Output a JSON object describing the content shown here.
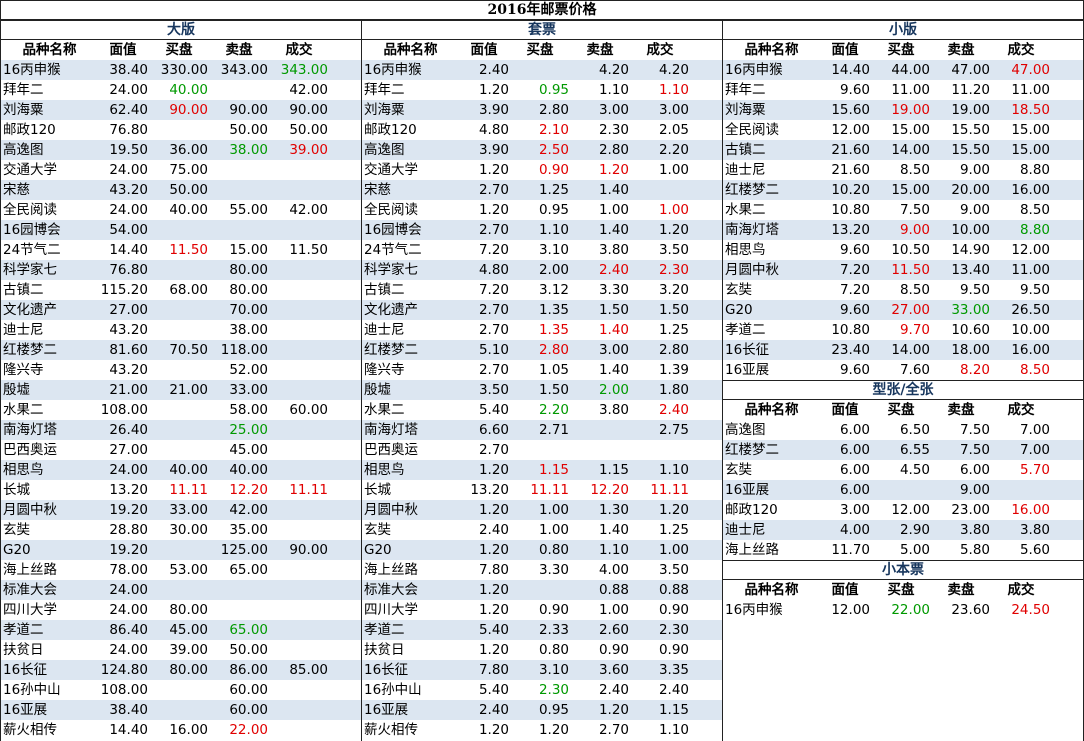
{
  "title": "2016年邮票价格",
  "headers": [
    "品种名称",
    "面值",
    "买盘",
    "卖盘",
    "成交"
  ],
  "sections": {
    "large": {
      "title": "大版",
      "rows": [
        [
          "16丙申猴",
          "38.40",
          "330.00",
          "343.00",
          "343.00"
        ],
        [
          "拜年二",
          "24.00",
          "40.00",
          "",
          "42.00"
        ],
        [
          "刘海粟",
          "62.40",
          "90.00",
          "90.00",
          "90.00"
        ],
        [
          "邮政120",
          "76.80",
          "",
          "50.00",
          "50.00"
        ],
        [
          "高逸图",
          "19.50",
          "36.00",
          "38.00",
          "39.00"
        ],
        [
          "交通大学",
          "24.00",
          "75.00",
          "",
          ""
        ],
        [
          "宋慈",
          "43.20",
          "50.00",
          "",
          ""
        ],
        [
          "全民阅读",
          "24.00",
          "40.00",
          "55.00",
          "42.00"
        ],
        [
          "16园博会",
          "54.00",
          "",
          "",
          ""
        ],
        [
          "24节气二",
          "14.40",
          "11.50",
          "15.00",
          "11.50"
        ],
        [
          "科学家七",
          "76.80",
          "",
          "80.00",
          ""
        ],
        [
          "古镇二",
          "115.20",
          "68.00",
          "80.00",
          ""
        ],
        [
          "文化遗产",
          "27.00",
          "",
          "70.00",
          ""
        ],
        [
          "迪士尼",
          "43.20",
          "",
          "38.00",
          ""
        ],
        [
          "红楼梦二",
          "81.60",
          "70.50",
          "118.00",
          ""
        ],
        [
          "隆兴寺",
          "43.20",
          "",
          "52.00",
          ""
        ],
        [
          "殷墟",
          "21.00",
          "21.00",
          "33.00",
          ""
        ],
        [
          "水果二",
          "108.00",
          "",
          "58.00",
          "60.00"
        ],
        [
          "南海灯塔",
          "26.40",
          "",
          "25.00",
          ""
        ],
        [
          "巴西奥运",
          "27.00",
          "",
          "45.00",
          ""
        ],
        [
          "相思鸟",
          "24.00",
          "40.00",
          "40.00",
          ""
        ],
        [
          "长城",
          "13.20",
          "11.11",
          "12.20",
          "11.11"
        ],
        [
          "月圆中秋",
          "19.20",
          "33.00",
          "42.00",
          ""
        ],
        [
          "玄奘",
          "28.80",
          "30.00",
          "35.00",
          ""
        ],
        [
          "G20",
          "19.20",
          "",
          "125.00",
          "90.00"
        ],
        [
          "海上丝路",
          "78.00",
          "53.00",
          "65.00",
          ""
        ],
        [
          "标准大会",
          "24.00",
          "",
          "",
          ""
        ],
        [
          "四川大学",
          "24.00",
          "80.00",
          "",
          ""
        ],
        [
          "孝道二",
          "86.40",
          "45.00",
          "65.00",
          ""
        ],
        [
          "扶贫日",
          "24.00",
          "39.00",
          "50.00",
          ""
        ],
        [
          "16长征",
          "124.80",
          "80.00",
          "86.00",
          "85.00"
        ],
        [
          "16孙中山",
          "108.00",
          "",
          "60.00",
          ""
        ],
        [
          "16亚展",
          "38.40",
          "",
          "60.00",
          ""
        ],
        [
          "薪火相传",
          "14.40",
          "16.00",
          "22.00",
          ""
        ]
      ],
      "colors": [
        [
          "",
          "",
          "",
          "",
          "green"
        ],
        [
          "",
          "",
          "green",
          "",
          ""
        ],
        [
          "",
          "",
          "red",
          "",
          ""
        ],
        [
          "",
          "",
          "",
          "",
          ""
        ],
        [
          "",
          "",
          "",
          "green",
          "red"
        ],
        [
          "",
          "",
          "",
          "",
          ""
        ],
        [
          "",
          "",
          "",
          "",
          ""
        ],
        [
          "",
          "",
          "",
          "",
          ""
        ],
        [
          "",
          "",
          "",
          "",
          ""
        ],
        [
          "",
          "",
          "red",
          "",
          ""
        ],
        [
          "",
          "",
          "",
          "",
          ""
        ],
        [
          "",
          "",
          "",
          "",
          ""
        ],
        [
          "",
          "",
          "",
          "",
          ""
        ],
        [
          "",
          "",
          "",
          "",
          ""
        ],
        [
          "",
          "",
          "",
          "",
          ""
        ],
        [
          "",
          "",
          "",
          "",
          ""
        ],
        [
          "",
          "",
          "",
          "",
          ""
        ],
        [
          "",
          "",
          "",
          "",
          ""
        ],
        [
          "",
          "",
          "",
          "green",
          ""
        ],
        [
          "",
          "",
          "",
          "",
          ""
        ],
        [
          "",
          "",
          "",
          "",
          ""
        ],
        [
          "",
          "",
          "red",
          "red",
          "red"
        ],
        [
          "",
          "",
          "",
          "",
          ""
        ],
        [
          "",
          "",
          "",
          "",
          ""
        ],
        [
          "",
          "",
          "",
          "",
          ""
        ],
        [
          "",
          "",
          "",
          "",
          ""
        ],
        [
          "",
          "",
          "",
          "",
          ""
        ],
        [
          "",
          "",
          "",
          "",
          ""
        ],
        [
          "",
          "",
          "",
          "green",
          ""
        ],
        [
          "",
          "",
          "",
          "",
          ""
        ],
        [
          "",
          "",
          "",
          "",
          ""
        ],
        [
          "",
          "",
          "",
          "",
          ""
        ],
        [
          "",
          "",
          "",
          "",
          ""
        ],
        [
          "",
          "",
          "",
          "red",
          ""
        ]
      ]
    },
    "sets": {
      "title": "套票",
      "rows": [
        [
          "16丙申猴",
          "2.40",
          "",
          "4.20",
          "4.20"
        ],
        [
          "拜年二",
          "1.20",
          "0.95",
          "1.10",
          "1.10"
        ],
        [
          "刘海粟",
          "3.90",
          "2.80",
          "3.00",
          "3.00"
        ],
        [
          "邮政120",
          "4.80",
          "2.10",
          "2.30",
          "2.05"
        ],
        [
          "高逸图",
          "3.90",
          "2.50",
          "2.80",
          "2.20"
        ],
        [
          "交通大学",
          "1.20",
          "0.90",
          "1.20",
          "1.00"
        ],
        [
          "宋慈",
          "2.70",
          "1.25",
          "1.40",
          ""
        ],
        [
          "全民阅读",
          "1.20",
          "0.95",
          "1.00",
          "1.00"
        ],
        [
          "16园博会",
          "2.70",
          "1.10",
          "1.40",
          "1.20"
        ],
        [
          "24节气二",
          "7.20",
          "3.10",
          "3.80",
          "3.50"
        ],
        [
          "科学家七",
          "4.80",
          "2.00",
          "2.40",
          "2.30"
        ],
        [
          "古镇二",
          "7.20",
          "3.12",
          "3.30",
          "3.20"
        ],
        [
          "文化遗产",
          "2.70",
          "1.35",
          "1.50",
          "1.50"
        ],
        [
          "迪士尼",
          "2.70",
          "1.35",
          "1.40",
          "1.25"
        ],
        [
          "红楼梦二",
          "5.10",
          "2.80",
          "3.00",
          "2.80"
        ],
        [
          "隆兴寺",
          "2.70",
          "1.05",
          "1.40",
          "1.39"
        ],
        [
          "殷墟",
          "3.50",
          "1.50",
          "2.00",
          "1.80"
        ],
        [
          "水果二",
          "5.40",
          "2.20",
          "3.80",
          "2.40"
        ],
        [
          "南海灯塔",
          "6.60",
          "2.71",
          "",
          "2.75"
        ],
        [
          "巴西奥运",
          "2.70",
          "",
          "",
          ""
        ],
        [
          "相思鸟",
          "1.20",
          "1.15",
          "1.15",
          "1.10"
        ],
        [
          "长城",
          "13.20",
          "11.11",
          "12.20",
          "11.11"
        ],
        [
          "月圆中秋",
          "1.20",
          "1.00",
          "1.30",
          "1.20"
        ],
        [
          "玄奘",
          "2.40",
          "1.00",
          "1.40",
          "1.25"
        ],
        [
          "G20",
          "1.20",
          "0.80",
          "1.10",
          "1.00"
        ],
        [
          "海上丝路",
          "7.80",
          "3.30",
          "4.00",
          "3.50"
        ],
        [
          "标准大会",
          "1.20",
          "",
          "0.88",
          "0.88"
        ],
        [
          "四川大学",
          "1.20",
          "0.90",
          "1.00",
          "0.90"
        ],
        [
          "孝道二",
          "5.40",
          "2.33",
          "2.60",
          "2.30"
        ],
        [
          "扶贫日",
          "1.20",
          "0.80",
          "0.90",
          "0.90"
        ],
        [
          "16长征",
          "7.80",
          "3.10",
          "3.60",
          "3.35"
        ],
        [
          "16孙中山",
          "5.40",
          "2.30",
          "2.40",
          "2.40"
        ],
        [
          "16亚展",
          "2.40",
          "0.95",
          "1.20",
          "1.15"
        ],
        [
          "薪火相传",
          "1.20",
          "1.20",
          "2.70",
          "1.10"
        ]
      ],
      "colors": [
        [
          "",
          "",
          "",
          "",
          ""
        ],
        [
          "",
          "",
          "green",
          "",
          "red"
        ],
        [
          "",
          "",
          "",
          "",
          ""
        ],
        [
          "",
          "",
          "red",
          "",
          ""
        ],
        [
          "",
          "",
          "red",
          "",
          ""
        ],
        [
          "",
          "",
          "red",
          "red",
          ""
        ],
        [
          "",
          "",
          "",
          "",
          ""
        ],
        [
          "",
          "",
          "",
          "",
          "red"
        ],
        [
          "",
          "",
          "",
          "",
          ""
        ],
        [
          "",
          "",
          "",
          "",
          ""
        ],
        [
          "",
          "",
          "",
          "red",
          "red"
        ],
        [
          "",
          "",
          "",
          "",
          ""
        ],
        [
          "",
          "",
          "",
          "",
          ""
        ],
        [
          "",
          "",
          "red",
          "red",
          ""
        ],
        [
          "",
          "",
          "red",
          "",
          ""
        ],
        [
          "",
          "",
          "",
          "",
          ""
        ],
        [
          "",
          "",
          "",
          "green",
          ""
        ],
        [
          "",
          "",
          "green",
          "",
          "red"
        ],
        [
          "",
          "",
          "",
          "",
          ""
        ],
        [
          "",
          "",
          "",
          "",
          ""
        ],
        [
          "",
          "",
          "red",
          "",
          ""
        ],
        [
          "",
          "",
          "red",
          "red",
          "red"
        ],
        [
          "",
          "",
          "",
          "",
          ""
        ],
        [
          "",
          "",
          "",
          "",
          ""
        ],
        [
          "",
          "",
          "",
          "",
          ""
        ],
        [
          "",
          "",
          "",
          "",
          ""
        ],
        [
          "",
          "",
          "",
          "",
          ""
        ],
        [
          "",
          "",
          "",
          "",
          ""
        ],
        [
          "",
          "",
          "",
          "",
          ""
        ],
        [
          "",
          "",
          "",
          "",
          ""
        ],
        [
          "",
          "",
          "",
          "",
          ""
        ],
        [
          "",
          "",
          "green",
          "",
          ""
        ],
        [
          "",
          "",
          "",
          "",
          ""
        ],
        [
          "",
          "",
          "",
          "",
          ""
        ]
      ]
    },
    "small": {
      "title": "小版",
      "rows": [
        [
          "16丙申猴",
          "14.40",
          "44.00",
          "47.00",
          "47.00"
        ],
        [
          "拜年二",
          "9.60",
          "11.00",
          "11.20",
          "11.00"
        ],
        [
          "刘海粟",
          "15.60",
          "19.00",
          "19.00",
          "18.50"
        ],
        [
          "全民阅读",
          "12.00",
          "15.00",
          "15.50",
          "15.00"
        ],
        [
          "古镇二",
          "21.60",
          "14.00",
          "15.50",
          "15.00"
        ],
        [
          "迪士尼",
          "21.60",
          "8.50",
          "9.00",
          "8.80"
        ],
        [
          "红楼梦二",
          "10.20",
          "15.00",
          "20.00",
          "16.00"
        ],
        [
          "水果二",
          "10.80",
          "7.50",
          "9.00",
          "8.50"
        ],
        [
          "南海灯塔",
          "13.20",
          "9.00",
          "10.00",
          "8.80"
        ],
        [
          "相思鸟",
          "9.60",
          "10.50",
          "14.90",
          "12.00"
        ],
        [
          "月圆中秋",
          "7.20",
          "11.50",
          "13.40",
          "11.00"
        ],
        [
          "玄奘",
          "7.20",
          "8.50",
          "9.50",
          "9.50"
        ],
        [
          "G20",
          "9.60",
          "27.00",
          "33.00",
          "26.50"
        ],
        [
          "孝道二",
          "10.80",
          "9.70",
          "10.60",
          "10.00"
        ],
        [
          "16长征",
          "23.40",
          "14.00",
          "18.00",
          "16.00"
        ],
        [
          "16亚展",
          "9.60",
          "7.60",
          "8.20",
          "8.50"
        ]
      ],
      "colors": [
        [
          "",
          "",
          "",
          "",
          "red"
        ],
        [
          "",
          "",
          "",
          "",
          ""
        ],
        [
          "",
          "",
          "red",
          "",
          "red"
        ],
        [
          "",
          "",
          "",
          "",
          ""
        ],
        [
          "",
          "",
          "",
          "",
          ""
        ],
        [
          "",
          "",
          "",
          "",
          ""
        ],
        [
          "",
          "",
          "",
          "",
          ""
        ],
        [
          "",
          "",
          "",
          "",
          ""
        ],
        [
          "",
          "",
          "red",
          "",
          "green"
        ],
        [
          "",
          "",
          "",
          "",
          ""
        ],
        [
          "",
          "",
          "red",
          "",
          ""
        ],
        [
          "",
          "",
          "",
          "",
          ""
        ],
        [
          "",
          "",
          "red",
          "green",
          ""
        ],
        [
          "",
          "",
          "red",
          "",
          ""
        ],
        [
          "",
          "",
          "",
          "",
          ""
        ],
        [
          "",
          "",
          "",
          "red",
          "red"
        ]
      ]
    },
    "sheetlet": {
      "title": "型张/全张",
      "rows": [
        [
          "高逸图",
          "6.00",
          "6.50",
          "7.50",
          "7.00"
        ],
        [
          "红楼梦二",
          "6.00",
          "6.55",
          "7.50",
          "7.00"
        ],
        [
          "玄奘",
          "6.00",
          "4.50",
          "6.00",
          "5.70"
        ],
        [
          "16亚展",
          "6.00",
          "",
          "9.00",
          ""
        ],
        [
          "邮政120",
          "3.00",
          "12.00",
          "23.00",
          "16.00"
        ],
        [
          "迪士尼",
          "4.00",
          "2.90",
          "3.80",
          "3.80"
        ],
        [
          "海上丝路",
          "11.70",
          "5.00",
          "5.80",
          "5.60"
        ]
      ],
      "colors": [
        [
          "",
          "",
          "",
          "",
          ""
        ],
        [
          "",
          "",
          "",
          "",
          ""
        ],
        [
          "",
          "",
          "",
          "",
          "red"
        ],
        [
          "",
          "",
          "",
          "",
          ""
        ],
        [
          "",
          "",
          "",
          "",
          "red"
        ],
        [
          "",
          "",
          "",
          "",
          ""
        ],
        [
          "",
          "",
          "",
          "",
          ""
        ]
      ]
    },
    "booklet": {
      "title": "小本票",
      "rows": [
        [
          "16丙申猴",
          "12.00",
          "22.00",
          "23.60",
          "24.50"
        ]
      ],
      "colors": [
        [
          "",
          "",
          "green",
          "",
          "red"
        ]
      ]
    }
  }
}
